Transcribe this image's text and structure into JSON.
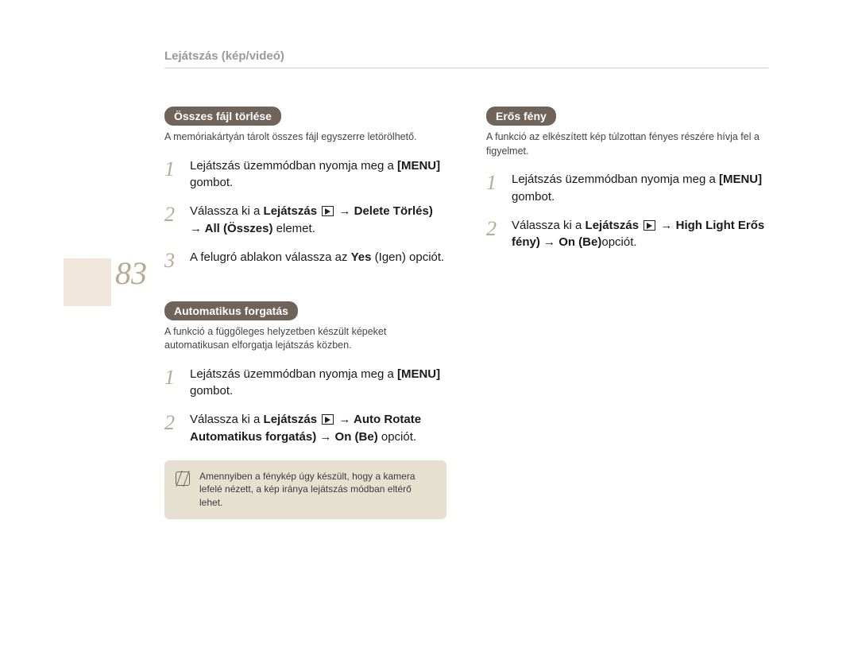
{
  "page_number": "83",
  "breadcrumb": "Lejátszás (kép/videó)",
  "left": {
    "section1": {
      "title": "Összes fájl törlése",
      "desc": "A memóriakártyán tárolt összes fájl egyszerre letörölhető.",
      "steps": {
        "s1_pre": "Lejátszás üzemmódban nyomja meg a ",
        "s1_strong": "[MENU]",
        "s1_post": " gombot.",
        "s2_pre": "Válassza ki a  ",
        "s2_strong1": "Lejátszás ",
        "s2_mid1": " → ",
        "s2_strong2": "Delete  Törlés)",
        "s2_mid2": " → ",
        "s2_strong3": "All (Összes)",
        "s2_post": " elemet.",
        "s3_pre": "A felugró ablakon válassza az ",
        "s3_strong": "Yes",
        "s3_post": " (Igen) opciót."
      }
    },
    "section2": {
      "title": "Automatikus forgatás",
      "desc": "A funkció a függőleges helyzetben készült képeket automatikusan elforgatja lejátszás közben.",
      "steps": {
        "s1_pre": "Lejátszás üzemmódban nyomja meg a ",
        "s1_strong": "[MENU]",
        "s1_post": " gombot.",
        "s2_pre": "Válassza ki a ",
        "s2_strong1": "Lejátszás ",
        "s2_mid1": " → ",
        "s2_strong2": "Auto Rotate  Automatikus forgatás)",
        "s2_mid2": " → ",
        "s2_strong3": "On (Be)",
        "s2_post": " opciót."
      },
      "note": "Amennyiben a fénykép úgy készült, hogy a kamera lefelé nézett, a kép iránya lejátszás módban eltérő lehet."
    }
  },
  "right": {
    "section1": {
      "title": "Erős fény",
      "desc": "A funkció az elkészített kép túlzottan fényes részére hívja fel a figyelmet.",
      "steps": {
        "s1_pre": "Lejátszás üzemmódban nyomja meg a ",
        "s1_strong": "[MENU]",
        "s1_post": " gombot.",
        "s2_pre": "Válassza ki a ",
        "s2_strong1": "Lejátszás ",
        "s2_mid1": " → ",
        "s2_strong2": "High Light  Erős fény)",
        "s2_mid2": " → ",
        "s2_strong3": "On (Be)",
        "s2_post": "opciót."
      }
    }
  },
  "step_numbers": {
    "n1": "1",
    "n2": "2",
    "n3": "3"
  }
}
